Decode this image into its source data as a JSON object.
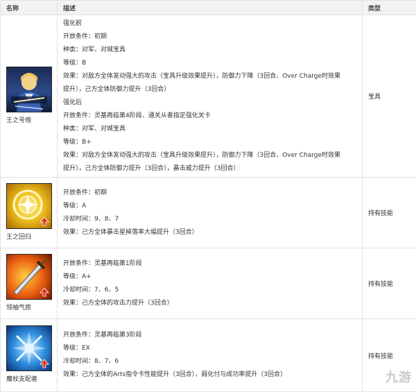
{
  "headers": {
    "name": "名称",
    "desc": "描述",
    "type": "类型"
  },
  "rows": [
    {
      "name": "王之号炮",
      "icon": "noble-phantasm-portrait-icon",
      "type": "宝具",
      "lines": [
        "强化前",
        "开放条件：初期",
        "种类：对军、对城宝具",
        "等级：B",
        "效果：对敌方全体发动强大的攻击（宝具升级效果提升），防御力下降（3回合、Over Charge时效果",
        "提升），己方全体防御力提升（3回合）",
        "强化后",
        "开放条件：灵基再临第4阶段、通关从者指定强化关卡",
        "种类：对军、对城宝具",
        "等级：B+",
        "效果：对敌方全体发动强大的攻击（宝具升级效果提升），防御力下降（3回合、Over Charge时效果",
        "提升），己方全体防御力提升（3回合），暴击威力提升（3回合）"
      ]
    },
    {
      "name": "王之回归",
      "icon": "star-drop-skill-icon",
      "type": "持有技能",
      "lines": [
        "开放条件：初期",
        "等级：A",
        "冷却时间：9、8、7",
        "效果：己方全体暴击星掉落率大幅提升（3回合）"
      ]
    },
    {
      "name": "领袖气质",
      "icon": "sword-attack-skill-icon",
      "type": "持有技能",
      "lines": [
        "开放条件：灵基再临第1阶段",
        "等级：A+",
        "冷却时间：7、6、5",
        "效果：己方全体的攻击力提升（3回合）"
      ]
    },
    {
      "name": "魔杖支配者",
      "icon": "arts-card-skill-icon",
      "type": "持有技能",
      "lines": [
        "开放条件：灵基再临第3阶段",
        "等级：EX",
        "冷却时间：8、7、6",
        "效果：己方全体的Arts指令卡性能提升（3回合），弱化付与成功率提升（3回合）"
      ]
    }
  ],
  "watermark": "九游"
}
